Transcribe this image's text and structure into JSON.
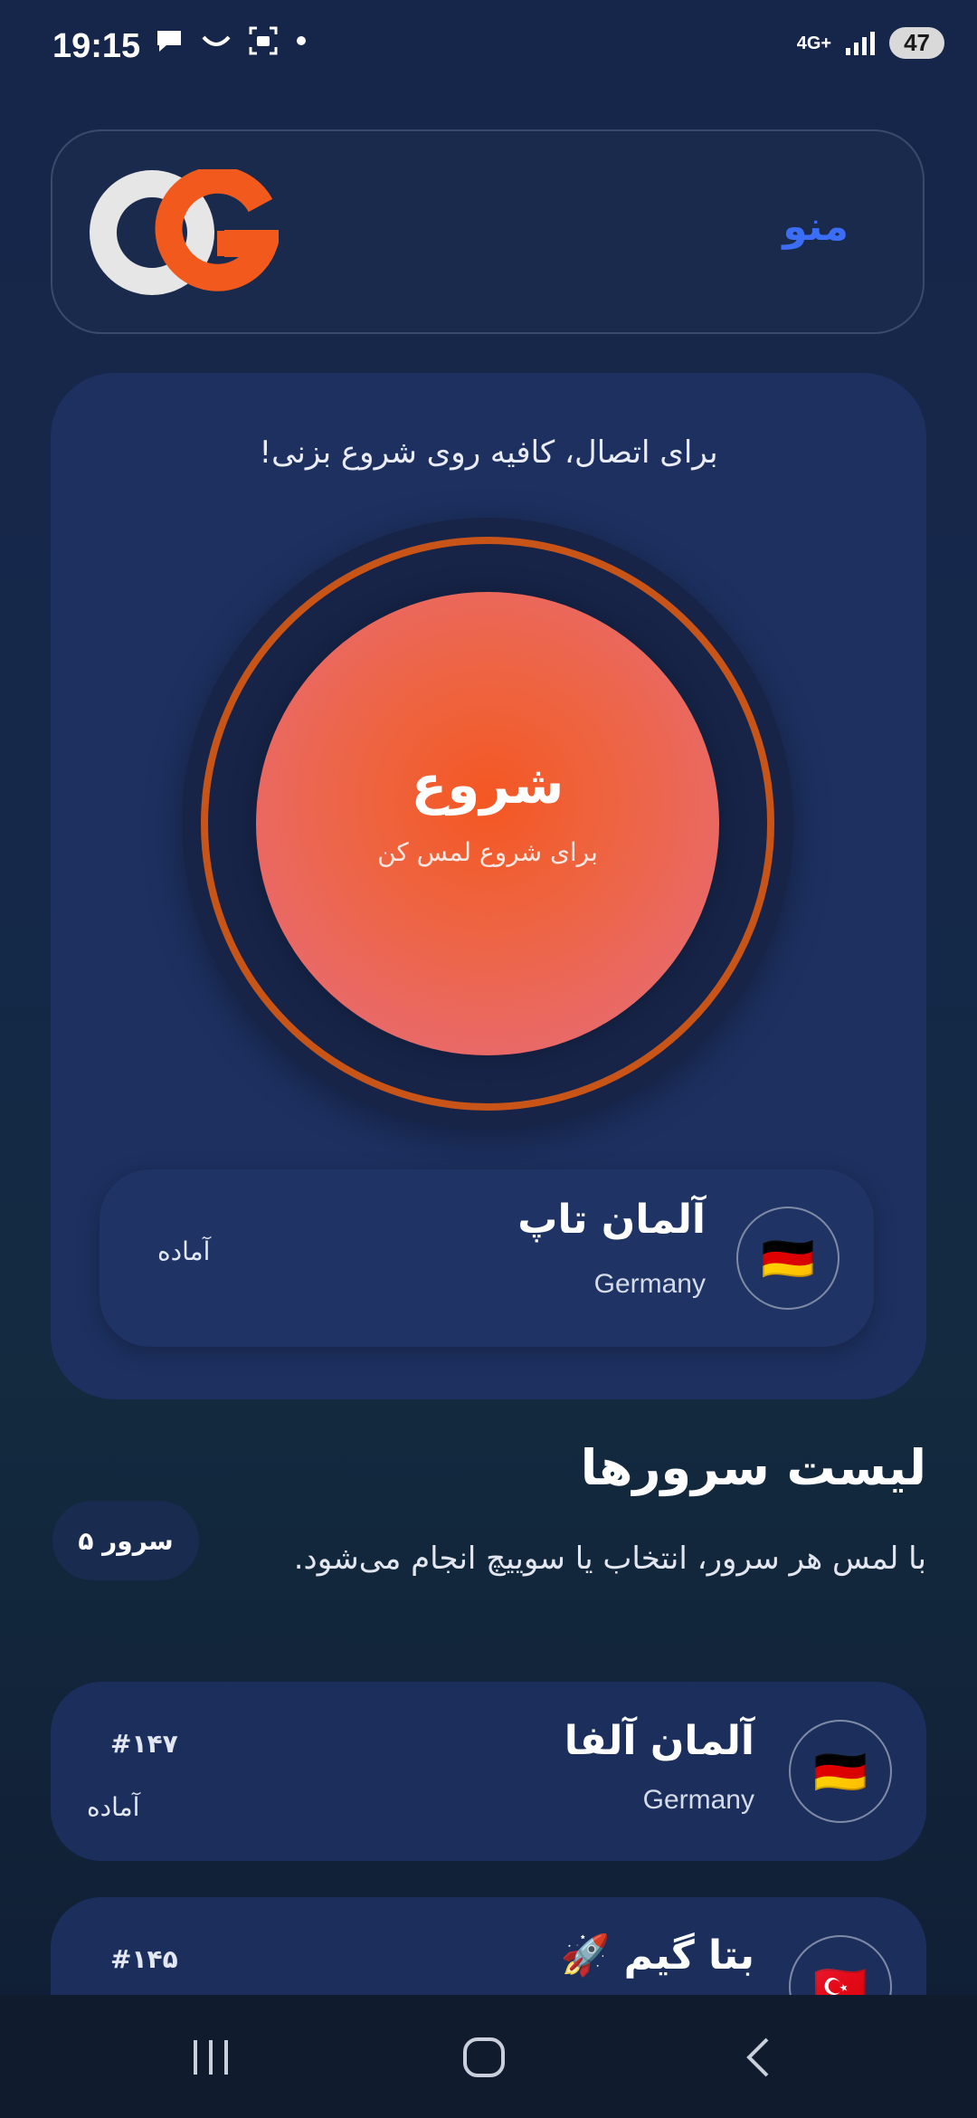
{
  "status_bar": {
    "time": "19:15",
    "network": "4G+",
    "battery": "47"
  },
  "header": {
    "menu_label": "منو",
    "logo_colors": {
      "left": "#e6e6e6",
      "right": "#f25a1d"
    }
  },
  "connect": {
    "hint": "برای اتصال، کافیه روی شروع بزنی!",
    "start_title": "شروع",
    "start_subtitle": "برای شروع لمس کن",
    "selected_server": {
      "name": "آلمان تاپ",
      "country": "Germany",
      "status": "آماده",
      "flag": "🇩🇪"
    }
  },
  "server_list": {
    "title": "لیست سرورها",
    "description": "با لمس هر سرور، انتخاب یا سوییچ انجام می‌شود.",
    "count_label": "۵ سرور",
    "items": [
      {
        "name": "آلمان آلفا",
        "country": "Germany",
        "id": "#۱۴۷",
        "status": "آماده",
        "flag": "🇩🇪"
      },
      {
        "name": "بتا گیم 🚀",
        "country": "",
        "id": "#۱۴۵",
        "status": "",
        "flag": "🇹🇷"
      }
    ]
  },
  "colors": {
    "accent_orange": "#f25a1d",
    "menu_blue": "#3b6df5",
    "card_bg": "#1d3060"
  },
  "nav": {
    "recents_icon": "recents-icon",
    "home_icon": "home-icon",
    "back_icon": "back-icon"
  }
}
